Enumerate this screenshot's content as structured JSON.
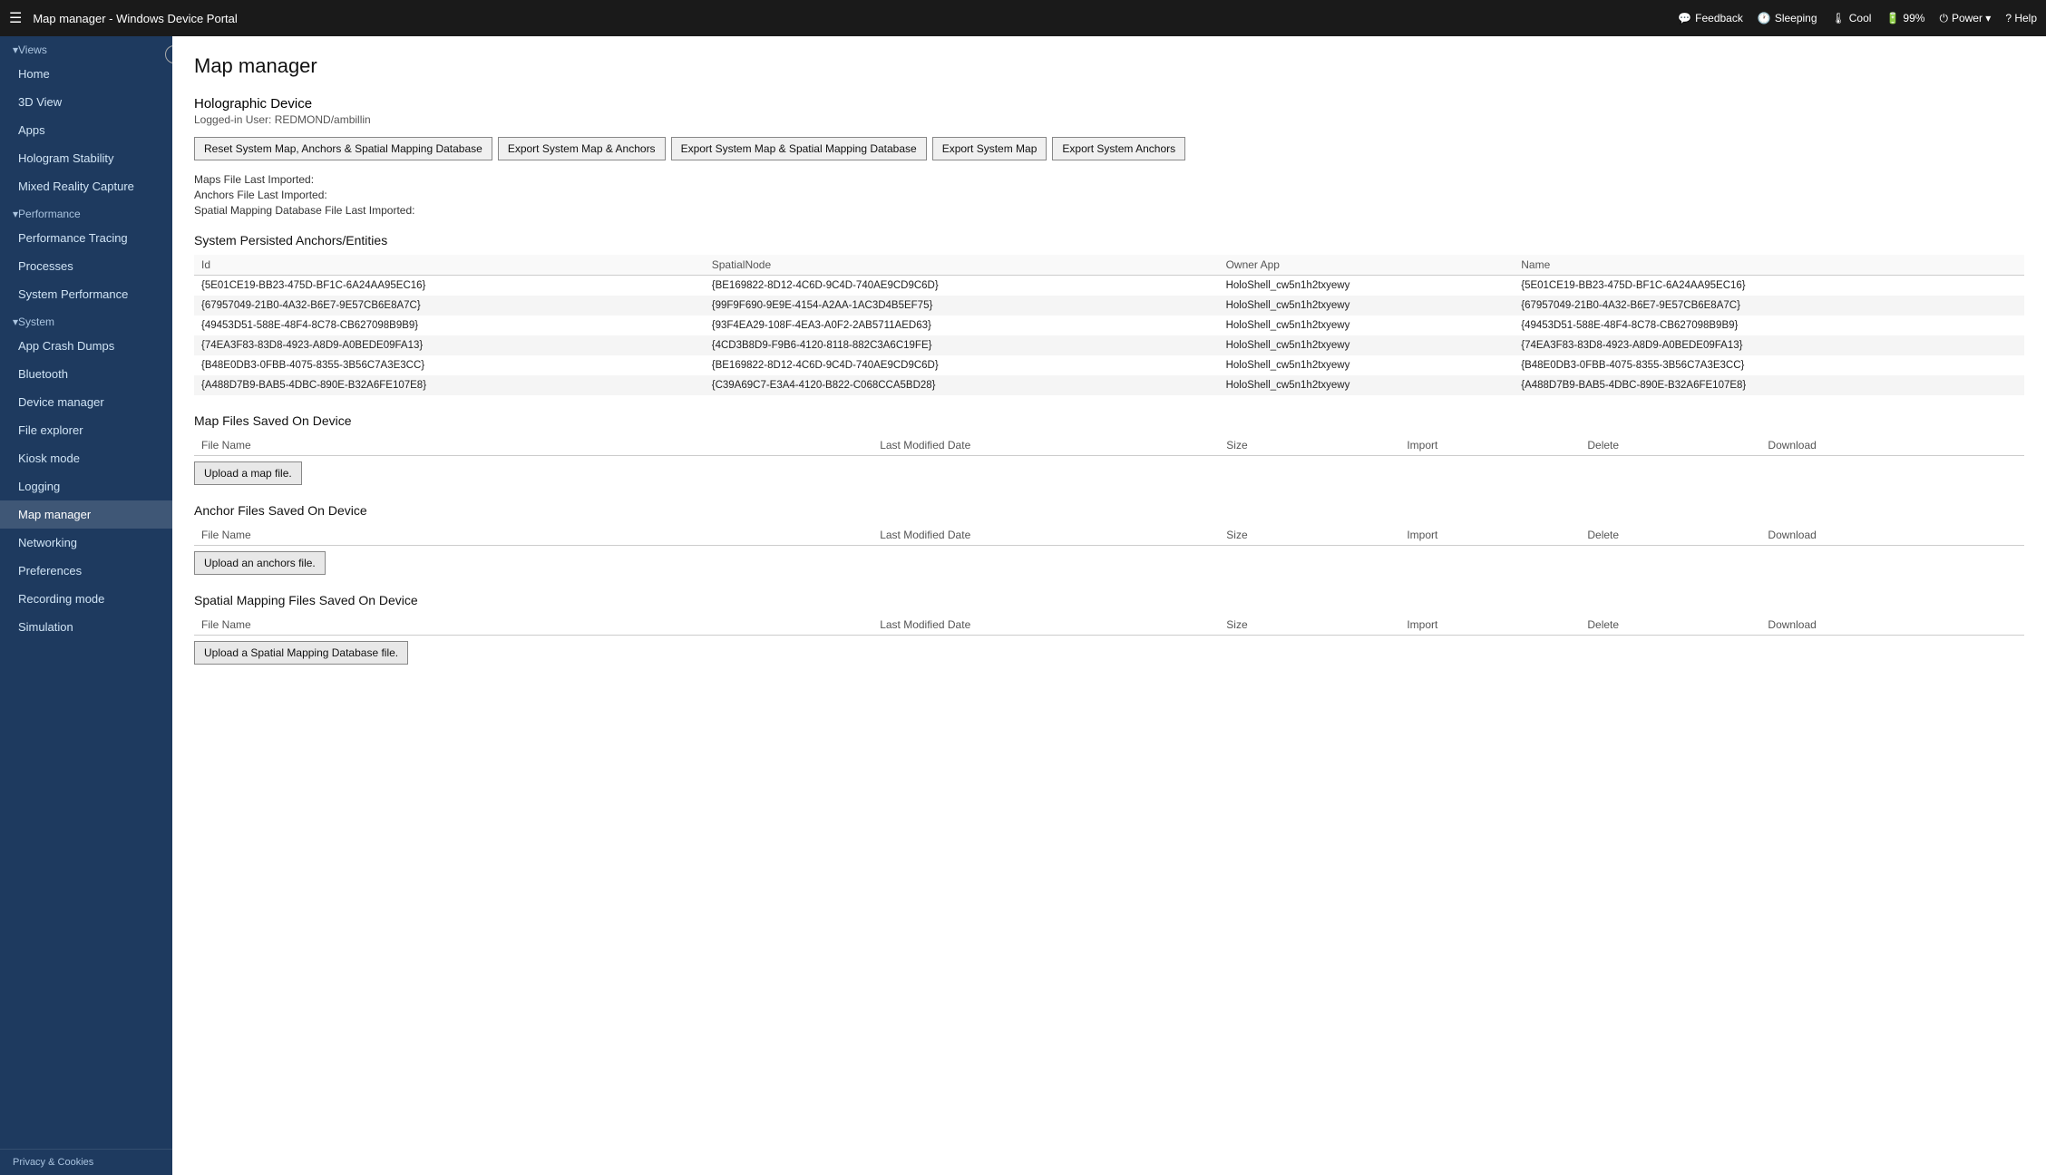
{
  "topbar": {
    "hamburger": "☰",
    "title": "Map manager - Windows Device Portal",
    "feedback_label": "Feedback",
    "sleeping_label": "Sleeping",
    "cool_label": "Cool",
    "battery_label": "99%",
    "power_label": "Power ▾",
    "help_label": "? Help"
  },
  "sidebar": {
    "collapse_icon": "‹",
    "views_label": "▾Views",
    "items_views": [
      {
        "label": "Home",
        "name": "sidebar-item-home"
      },
      {
        "label": "3D View",
        "name": "sidebar-item-3dview"
      },
      {
        "label": "Apps",
        "name": "sidebar-item-apps"
      },
      {
        "label": "Hologram Stability",
        "name": "sidebar-item-hologram"
      },
      {
        "label": "Mixed Reality Capture",
        "name": "sidebar-item-mrc"
      }
    ],
    "performance_label": "▾Performance",
    "items_performance": [
      {
        "label": "Performance Tracing",
        "name": "sidebar-item-perftracing"
      },
      {
        "label": "Processes",
        "name": "sidebar-item-processes"
      },
      {
        "label": "System Performance",
        "name": "sidebar-item-systperf"
      }
    ],
    "system_label": "▾System",
    "items_system": [
      {
        "label": "App Crash Dumps",
        "name": "sidebar-item-appcrashdumps"
      },
      {
        "label": "Bluetooth",
        "name": "sidebar-item-bluetooth"
      },
      {
        "label": "Device manager",
        "name": "sidebar-item-devicemgr"
      },
      {
        "label": "File explorer",
        "name": "sidebar-item-fileexplorer"
      },
      {
        "label": "Kiosk mode",
        "name": "sidebar-item-kioskmode"
      },
      {
        "label": "Logging",
        "name": "sidebar-item-logging"
      },
      {
        "label": "Map manager",
        "name": "sidebar-item-mapmanager",
        "active": true
      },
      {
        "label": "Networking",
        "name": "sidebar-item-networking"
      },
      {
        "label": "Preferences",
        "name": "sidebar-item-preferences"
      },
      {
        "label": "Recording mode",
        "name": "sidebar-item-recordingmode"
      },
      {
        "label": "Simulation",
        "name": "sidebar-item-simulation"
      }
    ],
    "privacy_label": "Privacy & Cookies"
  },
  "main": {
    "page_title": "Map manager",
    "device_name": "Holographic Device",
    "logged_in_user": "Logged-in User: REDMOND/ambillin",
    "buttons": [
      {
        "label": "Reset System Map, Anchors & Spatial Mapping Database",
        "name": "btn-reset"
      },
      {
        "label": "Export System Map & Anchors",
        "name": "btn-export-map-anchors"
      },
      {
        "label": "Export System Map & Spatial Mapping Database",
        "name": "btn-export-map-spatial"
      },
      {
        "label": "Export System Map",
        "name": "btn-export-map"
      },
      {
        "label": "Export System Anchors",
        "name": "btn-export-anchors"
      }
    ],
    "maps_file_last_imported": "Maps File Last Imported:",
    "anchors_file_last_imported": "Anchors File Last Imported:",
    "spatial_mapping_file_last_imported": "Spatial Mapping Database File Last Imported:",
    "anchors_section_title": "System Persisted Anchors/Entities",
    "anchors_table": {
      "columns": [
        "Id",
        "SpatialNode",
        "Owner App",
        "Name"
      ],
      "rows": [
        {
          "id": "{5E01CE19-BB23-475D-BF1C-6A24AA95EC16}",
          "spatial_node": "{BE169822-8D12-4C6D-9C4D-740AE9CD9C6D}",
          "owner_app": "HoloShell_cw5n1h2txyewy",
          "name": "{5E01CE19-BB23-475D-BF1C-6A24AA95EC16}"
        },
        {
          "id": "{67957049-21B0-4A32-B6E7-9E57CB6E8A7C}",
          "spatial_node": "{99F9F690-9E9E-4154-A2AA-1AC3D4B5EF75}",
          "owner_app": "HoloShell_cw5n1h2txyewy",
          "name": "{67957049-21B0-4A32-B6E7-9E57CB6E8A7C}"
        },
        {
          "id": "{49453D51-588E-48F4-8C78-CB627098B9B9}",
          "spatial_node": "{93F4EA29-108F-4EA3-A0F2-2AB5711AED63}",
          "owner_app": "HoloShell_cw5n1h2txyewy",
          "name": "{49453D51-588E-48F4-8C78-CB627098B9B9}"
        },
        {
          "id": "{74EA3F83-83D8-4923-A8D9-A0BEDE09FA13}",
          "spatial_node": "{4CD3B8D9-F9B6-4120-8118-882C3A6C19FE}",
          "owner_app": "HoloShell_cw5n1h2txyewy",
          "name": "{74EA3F83-83D8-4923-A8D9-A0BEDE09FA13}"
        },
        {
          "id": "{B48E0DB3-0FBB-4075-8355-3B56C7A3E3CC}",
          "spatial_node": "{BE169822-8D12-4C6D-9C4D-740AE9CD9C6D}",
          "owner_app": "HoloShell_cw5n1h2txyewy",
          "name": "{B48E0DB3-0FBB-4075-8355-3B56C7A3E3CC}"
        },
        {
          "id": "{A488D7B9-BAB5-4DBC-890E-B32A6FE107E8}",
          "spatial_node": "{C39A69C7-E3A4-4120-B822-C068CCA5BD28}",
          "owner_app": "HoloShell_cw5n1h2txyewy",
          "name": "{A488D7B9-BAB5-4DBC-890E-B32A6FE107E8}"
        }
      ]
    },
    "map_files_section": {
      "title": "Map Files Saved On Device",
      "columns": [
        "File Name",
        "Last Modified Date",
        "Size",
        "Import",
        "Delete",
        "Download"
      ],
      "upload_btn_label": "Upload a map file."
    },
    "anchor_files_section": {
      "title": "Anchor Files Saved On Device",
      "columns": [
        "File Name",
        "Last Modified Date",
        "Size",
        "Import",
        "Delete",
        "Download"
      ],
      "upload_btn_label": "Upload an anchors file."
    },
    "spatial_files_section": {
      "title": "Spatial Mapping Files Saved On Device",
      "columns": [
        "File Name",
        "Last Modified Date",
        "Size",
        "Import",
        "Delete",
        "Download"
      ],
      "upload_btn_label": "Upload a Spatial Mapping Database file."
    }
  }
}
